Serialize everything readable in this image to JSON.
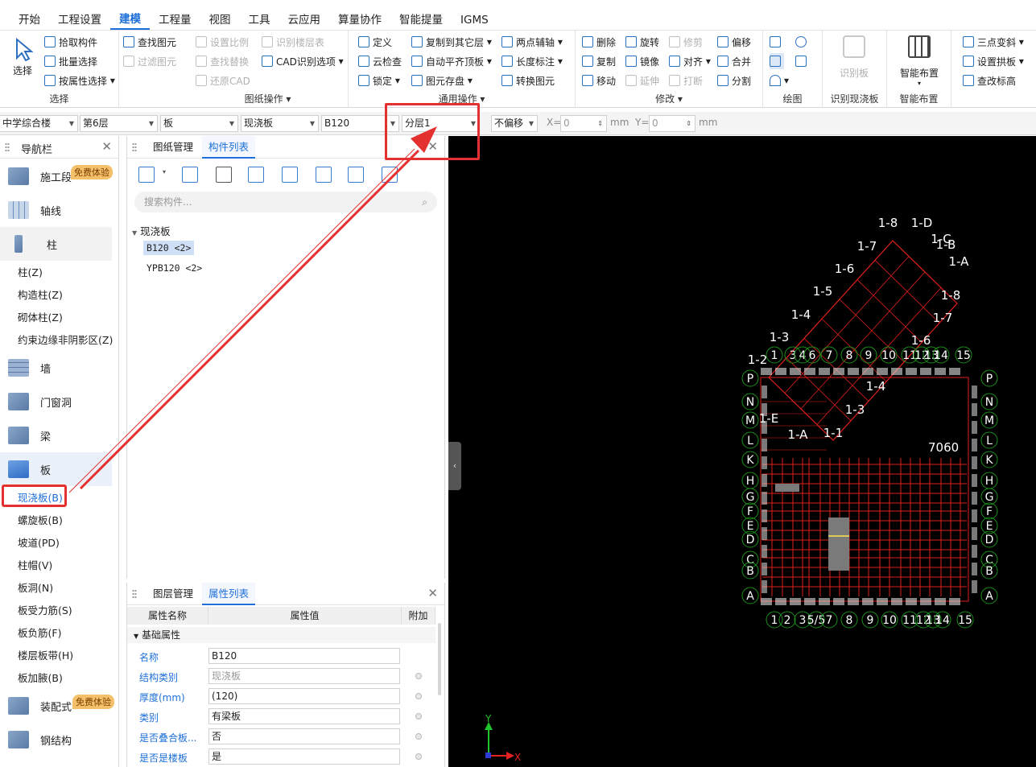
{
  "menu": [
    "开始",
    "工程设置",
    "建模",
    "工程量",
    "视图",
    "工具",
    "云应用",
    "算量协作",
    "智能提量",
    "IGMS"
  ],
  "menu_active": "建模",
  "ribbon": {
    "select_group": {
      "big_label": "选择",
      "items": [
        "拾取构件",
        "批量选择",
        "按属性选择"
      ],
      "label": "选择"
    },
    "find_group": {
      "items": [
        "查找图元",
        "过滤图元"
      ]
    },
    "drawing_ops": {
      "items": [
        "设置比例",
        "查找替换",
        "还原CAD",
        "识别楼层表",
        "CAD识别选项"
      ],
      "label": "图纸操作"
    },
    "common_ops": {
      "items": [
        "定义",
        "云检查",
        "锁定",
        "复制到其它层",
        "自动平齐顶板",
        "图元存盘",
        "两点辅轴",
        "长度标注",
        "转换图元"
      ],
      "label": "通用操作"
    },
    "modify": {
      "items": [
        "删除",
        "复制",
        "移动",
        "旋转",
        "镜像",
        "延伸",
        "修剪",
        "对齐",
        "打断",
        "偏移",
        "合并",
        "分割"
      ],
      "label": "修改"
    },
    "draw": {
      "label": "绘图"
    },
    "recognize": {
      "big_label": "识别板",
      "label": "识别现浇板"
    },
    "smart": {
      "big_label": "智能布置",
      "label": "智能布置"
    },
    "extra": {
      "items": [
        "三点变斜",
        "设置拱板",
        "查改标高"
      ]
    }
  },
  "propbar": {
    "building": "中学综合楼",
    "floor": "第6层",
    "category": "板",
    "type": "现浇板",
    "component": "B120",
    "layer": "分层1",
    "offset": "不偏移",
    "x_label": "X=",
    "x_value": "0",
    "y_label": "Y=",
    "y_value": "0",
    "unit": "mm"
  },
  "nav": {
    "title": "导航栏",
    "categories": [
      "施工段",
      "轴线",
      "柱",
      "墙",
      "门窗洞",
      "梁",
      "板",
      "装配式",
      "钢结构"
    ],
    "badge": "免费体验",
    "col_items": [
      "柱(Z)",
      "构造柱(Z)",
      "砌体柱(Z)",
      "约束边缘非阴影区(Z)"
    ],
    "slab_items": [
      "现浇板(B)",
      "螺旋板(B)",
      "坡道(PD)",
      "柱帽(V)",
      "板洞(N)",
      "板受力筋(S)",
      "板负筋(F)",
      "楼层板带(H)",
      "板加腋(B)"
    ]
  },
  "left": {
    "tabs": [
      "图纸管理",
      "构件列表"
    ],
    "search_placeholder": "搜索构件...",
    "tree_root": "现浇板",
    "tree_items": [
      "B120 <2>",
      "YPB120 <2>"
    ]
  },
  "props": {
    "tabs": [
      "图层管理",
      "属性列表"
    ],
    "headers": [
      "属性名称",
      "属性值",
      "附加"
    ],
    "section": "基础属性",
    "rows": [
      {
        "name": "名称",
        "value": "B120"
      },
      {
        "name": "结构类别",
        "value": "现浇板"
      },
      {
        "name": "厚度(mm)",
        "value": "(120)"
      },
      {
        "name": "类别",
        "value": "有梁板"
      },
      {
        "name": "是否叠合板...",
        "value": "否"
      },
      {
        "name": "是否是楼板",
        "value": "是"
      }
    ]
  },
  "canvas": {
    "top_axis": "1 3 4 6 7 8 9 10 11 12 13 14 15",
    "bottom_axis": "1 2 3 5/5 7 8 9 10 11 12 13 14 15",
    "left_axis": [
      "P",
      "N",
      "M",
      "L",
      "K",
      "H",
      "G",
      "F",
      "E",
      "D",
      "C",
      "B",
      "A"
    ],
    "dimension": "7060",
    "diag_top": [
      "1-8",
      "1-D",
      "1-C",
      "1-B",
      "1-A",
      "1-7",
      "1-6",
      "1-5",
      "1-4",
      "1-3",
      "1-2"
    ],
    "diag_right": [
      "1-8",
      "1-7",
      "1-6"
    ],
    "diag_lower": [
      "1-4",
      "1-3",
      "1-E",
      "1-A",
      "1-1"
    ],
    "axis_x": "X",
    "axis_y": "Y",
    "colors": {
      "grid": "#e0201c",
      "bubble": "#1b8f1b",
      "text": "#ffffff",
      "bg": "#000000"
    }
  }
}
